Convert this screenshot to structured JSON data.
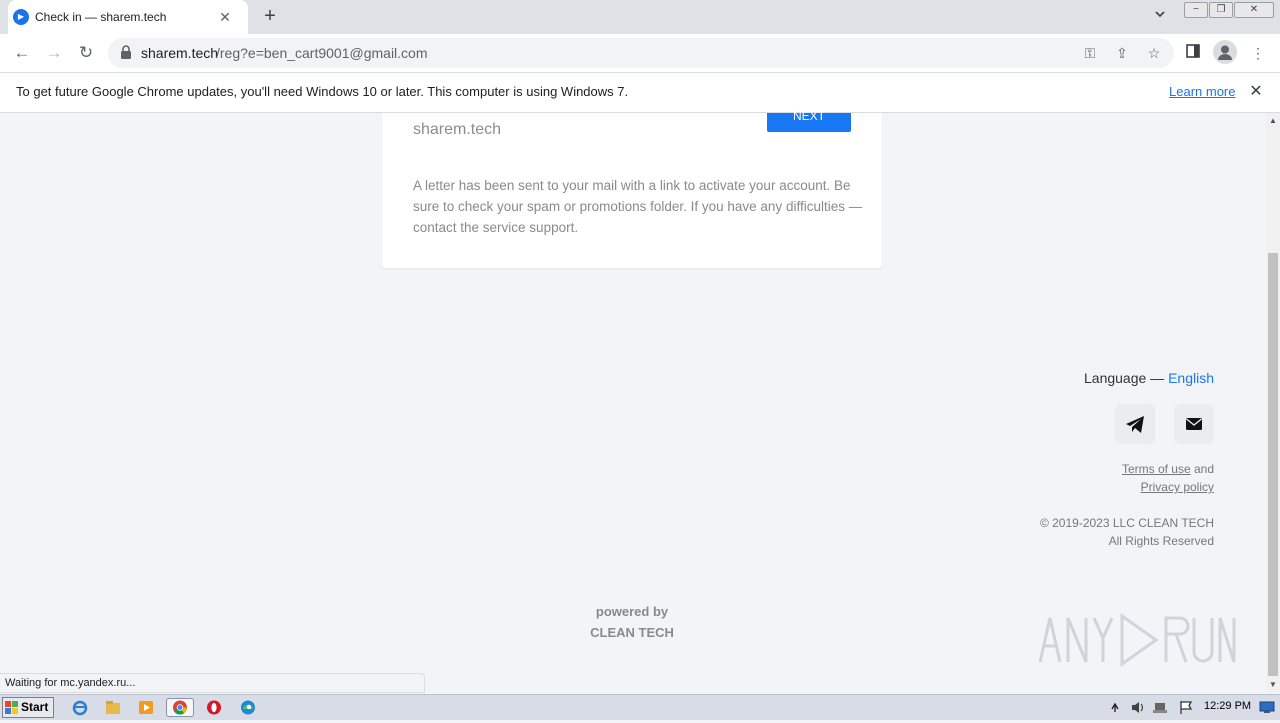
{
  "browser": {
    "tab": {
      "title": "Check in — sharem.tech"
    },
    "address": {
      "host": "sharem.tech",
      "path": "/reg?e=ben_cart9001@gmail.com"
    },
    "infobar": {
      "message": "To get future Google Chrome updates, you'll need Windows 10 or later. This computer is using Windows 7.",
      "learn_more": "Learn more"
    },
    "status": "Waiting for mc.yandex.ru..."
  },
  "card": {
    "site": "sharem.tech",
    "next_label": "NEXT",
    "message": "A letter has been sent to your mail with a link to activate your account. Be sure to check your spam or promotions folder. If you have any difficulties — contact the service support."
  },
  "footer": {
    "language_label": "Language — ",
    "language_value": "English",
    "terms": "Terms of use",
    "and": " and",
    "privacy": "Privacy policy",
    "copyright": "© 2019-2023 LLC CLEAN TECH",
    "rights": "All Rights Reserved",
    "powered_by": "powered by",
    "powered_brand": "CLEAN TECH"
  },
  "watermark": "ANY RUN",
  "taskbar": {
    "start": "Start",
    "clock": "12:29 PM"
  },
  "colors": {
    "accent": "#1877f2",
    "page_bg": "#f3f4f8",
    "chrome_blue": "#1a73e8"
  },
  "icons": {
    "tab_close": "✕",
    "new_tab": "+",
    "tab_search": "⌄",
    "back": "←",
    "forward": "→",
    "reload": "↻",
    "key": "⚿",
    "share": "⇪",
    "star": "☆",
    "sidepanel": "▮",
    "menu": "⋮",
    "info_close": "✕",
    "win_min": "−",
    "win_max": "❐",
    "win_close": "✕",
    "scroll_up": "▲",
    "scroll_down": "▼"
  }
}
